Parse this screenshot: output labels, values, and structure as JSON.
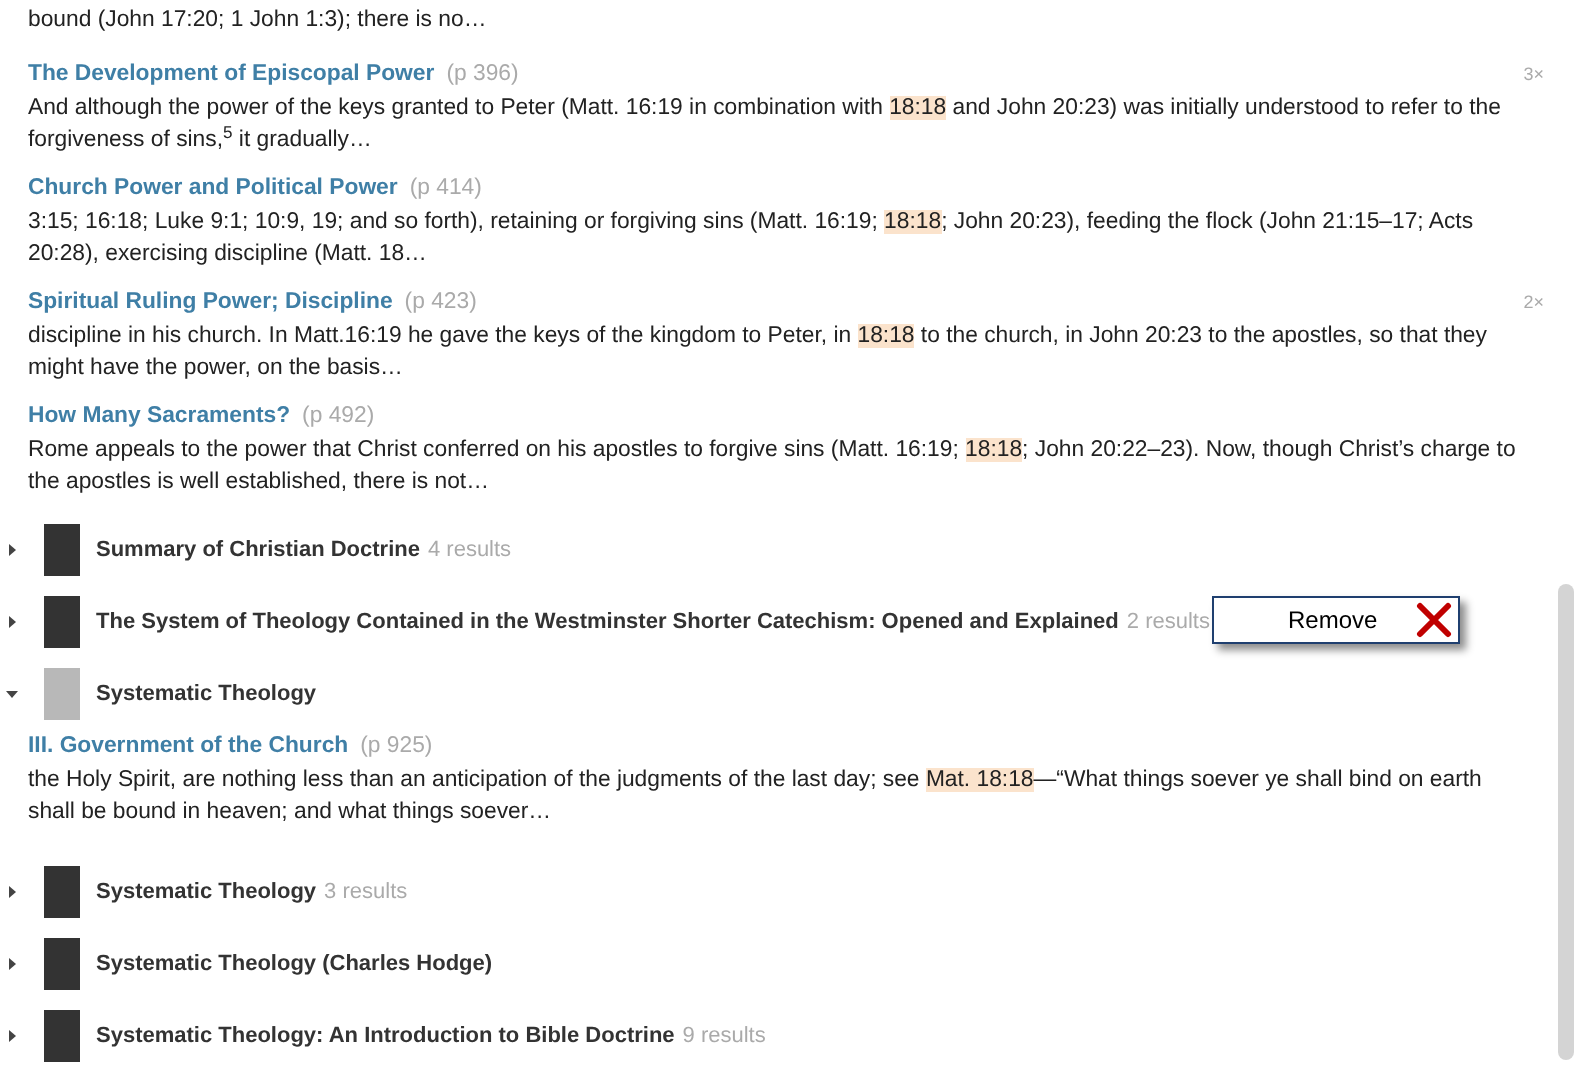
{
  "lead_snippet": [
    {
      "text": "bound (John 17:20; 1 John 1:3); there is no…",
      "highlighted": false
    }
  ],
  "hits": [
    {
      "title": "The Development of Episcopal Power",
      "page": "(p 396)",
      "count": "3×",
      "snippet": [
        {
          "text": "And although the power of the keys granted to Peter (Matt. 16:19 in combination with ",
          "highlighted": false
        },
        {
          "text": "18:18",
          "highlighted": true
        },
        {
          "text": " and John 20:23) was initially understood to refer to the forgiveness of sins,$^{5}$ it gradually…",
          "highlighted": false
        }
      ]
    },
    {
      "title": "Church Power and Political Power",
      "page": "(p 414)",
      "snippet": [
        {
          "text": "3:15; 16:18; Luke 9:1; 10:9, 19; and so forth), retaining or forgiving sins (Matt. 16:19; ",
          "highlighted": false
        },
        {
          "text": "18:18",
          "highlighted": true
        },
        {
          "text": "; John 20:23), feeding the flock (John 21:15–17; Acts 20:28), exercising discipline (Matt. 18…",
          "highlighted": false
        }
      ]
    },
    {
      "title": "Spiritual Ruling Power; Discipline",
      "page": "(p 423)",
      "count": "2×",
      "snippet": [
        {
          "text": "discipline in his church. In Matt.16:19 he gave the keys of the kingdom to Peter, in ",
          "highlighted": false
        },
        {
          "text": "18:18",
          "highlighted": true
        },
        {
          "text": " to the church, in John 20:23 to the apostles, so that they might have the power, on the basis…",
          "highlighted": false
        }
      ]
    },
    {
      "title": "How Many Sacraments?",
      "page": "(p 492)",
      "snippet": [
        {
          "text": "Rome appeals to the power that Christ conferred on his apostles to forgive sins (Matt. 16:19; ",
          "highlighted": false
        },
        {
          "text": "18:18",
          "highlighted": true
        },
        {
          "text": "; John 20:22–23). Now, though Christ’s charge to the apostles is well established, there is not…",
          "highlighted": false
        }
      ]
    }
  ],
  "books": [
    {
      "title": "Summary of Christian Doctrine",
      "results": "4 results",
      "expanded": false
    },
    {
      "title": "The System of Theology Contained in the Westminster Shorter Catechism: Opened and Explained",
      "results": "2 results",
      "expanded": false,
      "popup": {
        "label": "Remove"
      }
    },
    {
      "title": "Systematic Theology",
      "expanded": true,
      "hits": [
        {
          "title": "III. Government of the Church",
          "page": "(p 925)",
          "snippet": [
            {
              "text": "the Holy Spirit, are nothing less than an anticipation of the judgments of the last day; see ",
              "highlighted": false
            },
            {
              "text": "Mat. 18:18",
              "highlighted": true
            },
            {
              "text": "—“What things soever ye shall bind on earth shall be bound in heaven; and what things soever…",
              "highlighted": false
            }
          ]
        }
      ]
    },
    {
      "title": "Systematic Theology",
      "results": "3 results",
      "expanded": false
    },
    {
      "title": "Systematic Theology (Charles Hodge)",
      "expanded": false
    },
    {
      "title": "Systematic Theology: An Introduction to Bible Doctrine",
      "results": "9 results",
      "expanded": false
    }
  ]
}
